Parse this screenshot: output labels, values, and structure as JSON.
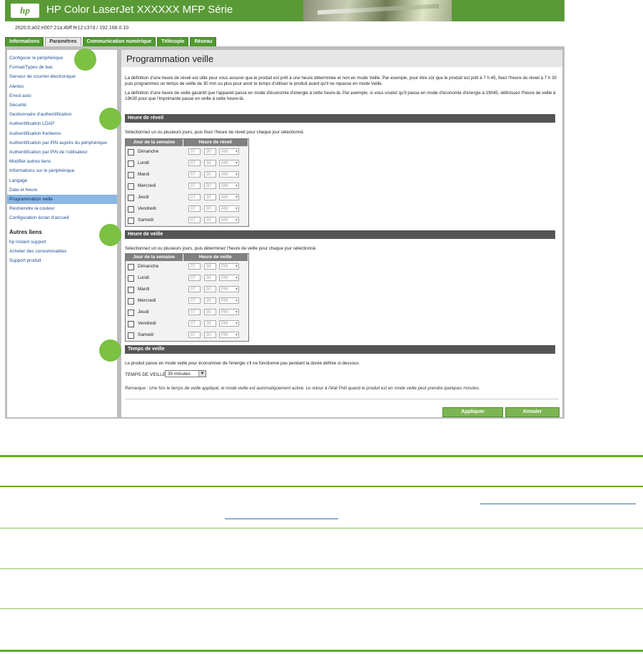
{
  "header": {
    "logo_text": "hp",
    "title": "HP Color LaserJet XXXXXX MFP Série",
    "address": "2620:0:a02:e007:21a:4bff:fe12:c37d / 192.168.0.10"
  },
  "tabs": [
    "Informations",
    "Paramètres",
    "Communication numérique",
    "Télécopie",
    "Réseau"
  ],
  "sidebar": {
    "items": [
      "Configurer le périphérique",
      "Format/Types de bac",
      "Serveur de courrier électronique",
      "Alertes",
      "Envoi auto",
      "Sécurité",
      "Gestionnaire d'authentification",
      "Authentification LDAP",
      "Authentification Kerberos",
      "Authentification par PIN auprès du périphérique",
      "Authentification par PIN de l'utilisateur",
      "Modifier autres liens",
      "Informations sur le périphérique",
      "Langage",
      "Date et heure",
      "Programmation veille",
      "Restreindre la couleur",
      "Configuration écran d'accueil"
    ],
    "other_heading": "Autres liens",
    "other_items": [
      "hp instant support",
      "Acheter des consommables",
      "Support produit"
    ]
  },
  "main": {
    "title": "Programmation veille",
    "intro1": "La définition d'une heure de réveil est utile pour vous assurer que le produit est prêt à une heure déterminée et non en mode Veille. Par exemple, pour être sûr que le produit est prêt à 7 h 45, fixez l'heure du réveil à 7 h 30 puis programmez un temps de veille de 30 min ou plus pour avoir le temps d'utiliser le produit avant qu'il ne repasse en mode Veille.",
    "intro2": "La définition d'une heure de veille garantit que l'appareil passe en mode d'économie d'énergie à cette heure-là. Par exemple, si vous voulez qu'il passe en mode d'économie d'énergie à 19h45, définissez l'heure de veille à 19h30 pour que l'imprimante passe en veille à cette heure-là.",
    "wake_heading": "Heure de réveil",
    "wake_instr": "Sélectionnez un ou plusieurs jours, puis fixez l'heure de réveil pour chaque jour sélectionné.",
    "wake_cols": [
      "Jour de la semaine",
      "Heure de réveil"
    ],
    "sleep_heading": "Heure de veille",
    "sleep_instr": "Sélectionnez un ou plusieurs jours, puis déterminez l'heure de veille pour chaque jour sélectionné.",
    "sleep_cols": [
      "Jour de la semaine",
      "Heure de veille"
    ],
    "days": [
      "Dimanche",
      "Lundi",
      "Mardi",
      "Mercredi",
      "Jeudi",
      "Vendredi",
      "Samedi"
    ],
    "hour": "07",
    "minute": "30",
    "wake_ampm": "AM",
    "sleep_ampm": "PM",
    "colon": ":",
    "delay_heading": "Temps de veille",
    "delay_instr": "Le produit passe en mode veille pour économiser de l'énergie s'il ne fonctionne pas pendant la durée définie ci-dessous.",
    "delay_label": "TEMPS DE VEILLE",
    "delay_value": "30 minutes",
    "remark": "Remarque : Une fois le temps de veille appliqué, le mode veille est automatiquement activé. Le retour à l'état Prêt quand le produit est en mode veille peut prendre quelques minutes.",
    "apply": "Appliquer",
    "cancel": "Annuler"
  },
  "colors": {
    "accent": "#5cb022",
    "header": "#5a9a36",
    "selected": "#8cb6e3",
    "section_bar": "#555555"
  }
}
